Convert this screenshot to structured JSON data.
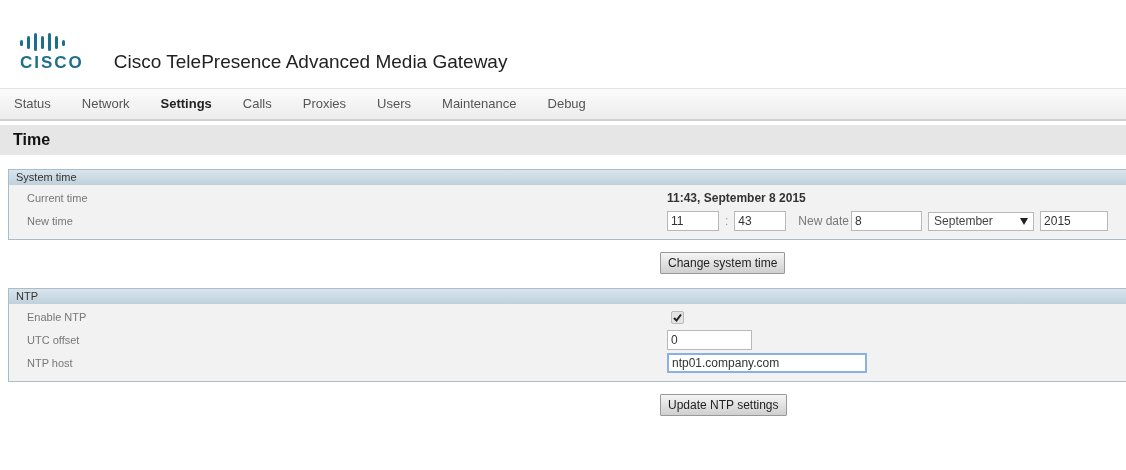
{
  "logo": {
    "wordmark": "CISCO"
  },
  "product_title": "Cisco TelePresence Advanced Media Gateway",
  "nav": [
    {
      "label": "Status",
      "selected": false
    },
    {
      "label": "Network",
      "selected": false
    },
    {
      "label": "Settings",
      "selected": true
    },
    {
      "label": "Calls",
      "selected": false
    },
    {
      "label": "Proxies",
      "selected": false
    },
    {
      "label": "Users",
      "selected": false
    },
    {
      "label": "Maintenance",
      "selected": false
    },
    {
      "label": "Debug",
      "selected": false
    }
  ],
  "page_title": "Time",
  "sections": [
    {
      "title": "System time",
      "rows": [
        {
          "kind": "text",
          "label": "Current time",
          "value": "11:43, September 8 2015"
        },
        {
          "kind": "datetime",
          "label": "New time",
          "hour": "11",
          "separator": ":",
          "minute": "43",
          "date_label": "New date",
          "day": "8",
          "month": "September",
          "year": "2015"
        }
      ],
      "button": "Change system time"
    },
    {
      "title": "NTP",
      "rows": [
        {
          "kind": "checkbox",
          "label": "Enable NTP",
          "checked": true
        },
        {
          "kind": "number",
          "label": "UTC offset",
          "value": "0",
          "focused": false
        },
        {
          "kind": "host",
          "label": "NTP host",
          "value": "ntp01.company.com",
          "focused": true
        }
      ],
      "button": "Update NTP settings"
    }
  ]
}
